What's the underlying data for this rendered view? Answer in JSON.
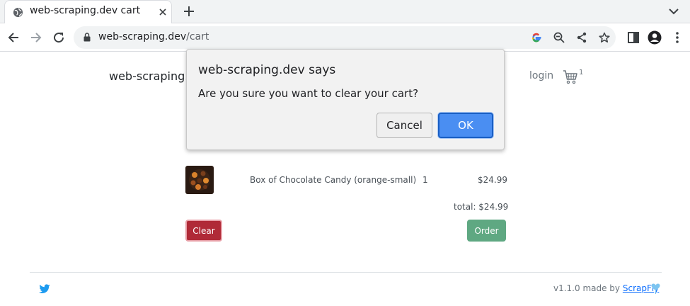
{
  "browser": {
    "tab": {
      "title": "web-scraping.dev cart",
      "favicon": "globe-icon"
    },
    "address": {
      "host": "web-scraping.dev",
      "path": "/cart"
    }
  },
  "site": {
    "brand": "web-scraping.dev",
    "nav": {
      "login": "login",
      "cart_count": "1"
    }
  },
  "cart": {
    "items": [
      {
        "name": "Box of Chocolate Candy (orange-small)",
        "quantity": "1",
        "price": "$24.99"
      }
    ],
    "total": "total: $24.99",
    "clear_label": "Clear",
    "order_label": "Order"
  },
  "footer": {
    "made_by_text": "v1.1.0 made by",
    "made_by_link": "ScrapFly"
  },
  "dialog": {
    "title": "web-scraping.dev says",
    "message": "Are you sure you want to clear your cart?",
    "cancel_label": "Cancel",
    "ok_label": "OK"
  },
  "colors": {
    "clear_button": "#b02a37",
    "order_button": "#5fa882",
    "ok_button": "#4a8ef2",
    "link": "#0d6efd"
  }
}
